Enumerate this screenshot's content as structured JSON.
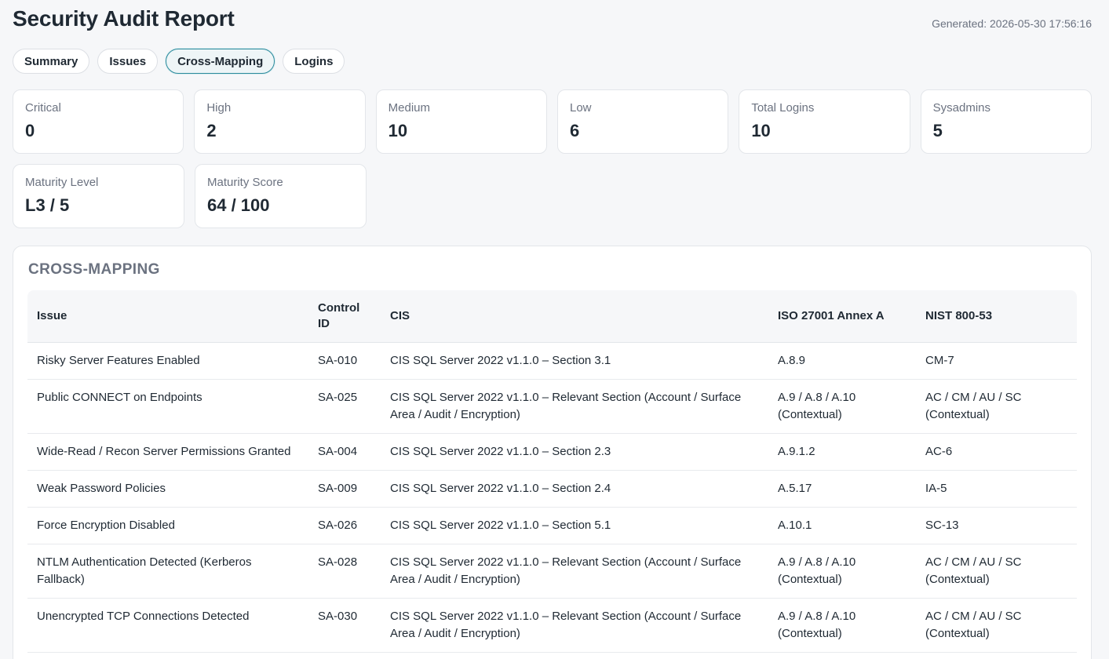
{
  "header": {
    "title": "Security Audit Report",
    "generated": "Generated: 2026-05-30 17:56:16"
  },
  "tabs": [
    {
      "label": "Summary",
      "active": false
    },
    {
      "label": "Issues",
      "active": false
    },
    {
      "label": "Cross-Mapping",
      "active": true
    },
    {
      "label": "Logins",
      "active": false
    }
  ],
  "cards": [
    {
      "label": "Critical",
      "value": "0"
    },
    {
      "label": "High",
      "value": "2"
    },
    {
      "label": "Medium",
      "value": "10"
    },
    {
      "label": "Low",
      "value": "6"
    },
    {
      "label": "Total Logins",
      "value": "10"
    },
    {
      "label": "Sysadmins",
      "value": "5"
    },
    {
      "label": "Maturity Level",
      "value": "L3 / 5"
    },
    {
      "label": "Maturity Score",
      "value": "64 / 100"
    }
  ],
  "panel": {
    "title": "CROSS-MAPPING"
  },
  "table": {
    "headers": {
      "issue": "Issue",
      "control_id": "Control ID",
      "cis": "CIS",
      "iso": "ISO 27001 Annex A",
      "nist": "NIST 800-53"
    },
    "rows": [
      {
        "issue": "Risky Server Features Enabled",
        "control_id": "SA-010",
        "cis": "CIS SQL Server 2022 v1.1.0 – Section 3.1",
        "iso": "A.8.9",
        "nist": "CM-7"
      },
      {
        "issue": "Public CONNECT on Endpoints",
        "control_id": "SA-025",
        "cis": "CIS SQL Server 2022 v1.1.0 – Relevant Section (Account / Surface Area / Audit / Encryption)",
        "iso": "A.9 / A.8 / A.10 (Contextual)",
        "nist": "AC / CM / AU / SC (Contextual)"
      },
      {
        "issue": "Wide-Read / Recon Server Permissions Granted",
        "control_id": "SA-004",
        "cis": "CIS SQL Server 2022 v1.1.0 – Section 2.3",
        "iso": "A.9.1.2",
        "nist": "AC-6"
      },
      {
        "issue": "Weak Password Policies",
        "control_id": "SA-009",
        "cis": "CIS SQL Server 2022 v1.1.0 – Section 2.4",
        "iso": "A.5.17",
        "nist": "IA-5"
      },
      {
        "issue": "Force Encryption Disabled",
        "control_id": "SA-026",
        "cis": "CIS SQL Server 2022 v1.1.0 – Section 5.1",
        "iso": "A.10.1",
        "nist": "SC-13"
      },
      {
        "issue": "NTLM Authentication Detected (Kerberos Fallback)",
        "control_id": "SA-028",
        "cis": "CIS SQL Server 2022 v1.1.0 – Relevant Section (Account / Surface Area / Audit / Encryption)",
        "iso": "A.9 / A.8 / A.10 (Contextual)",
        "nist": "AC / CM / AU / SC (Contextual)"
      },
      {
        "issue": "Unencrypted TCP Connections Detected",
        "control_id": "SA-030",
        "cis": "CIS SQL Server 2022 v1.1.0 – Relevant Section (Account / Surface Area / Audit / Encryption)",
        "iso": "A.9 / A.8 / A.10 (Contextual)",
        "nist": "AC / CM / AU / SC (Contextual)"
      }
    ]
  }
}
